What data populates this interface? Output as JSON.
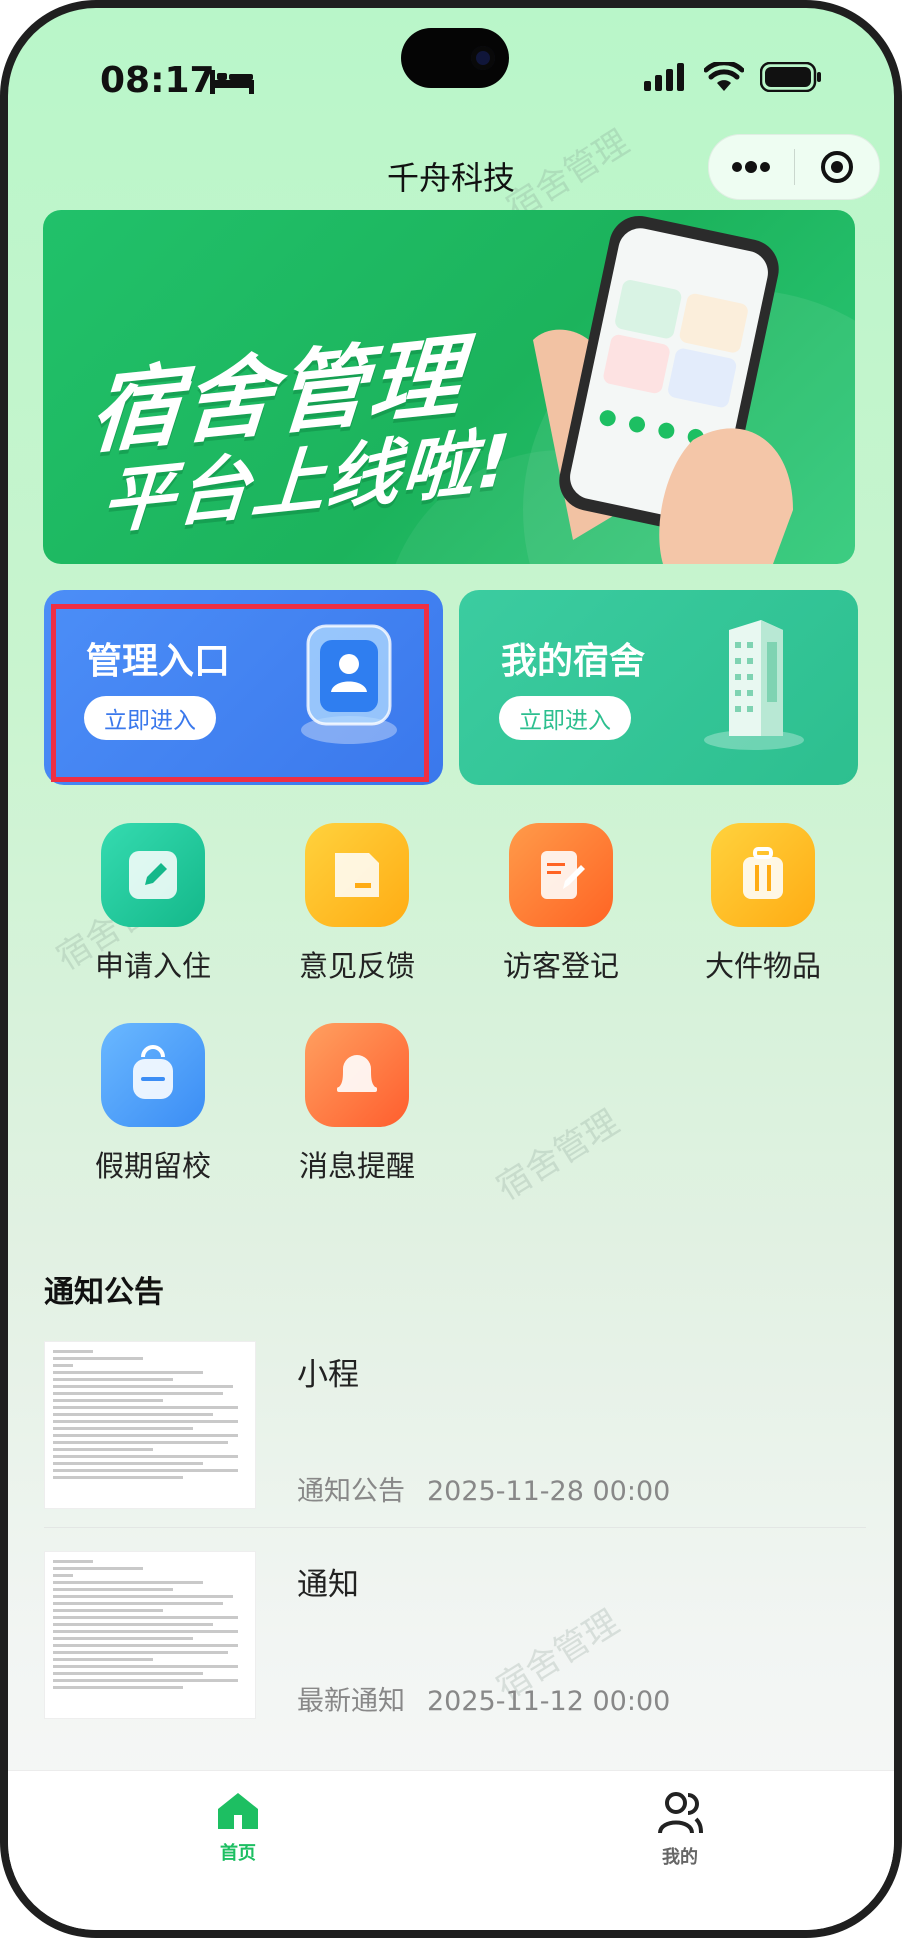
{
  "status_bar": {
    "time": "08:17"
  },
  "nav": {
    "title": "千舟科技"
  },
  "banner": {
    "line1": "宿舍管理",
    "line2": "平台上线啦!"
  },
  "cards": [
    {
      "title": "管理入口",
      "button": "立即进入"
    },
    {
      "title": "我的宿舍",
      "button": "立即进入"
    }
  ],
  "quick_actions": [
    {
      "label": "申请入住",
      "icon": "edit-icon",
      "color": "#1bc99a"
    },
    {
      "label": "意见反馈",
      "icon": "feedback-icon",
      "color": "#ffb81f"
    },
    {
      "label": "访客登记",
      "icon": "notebook-pen-icon",
      "color": "#ff7a36"
    },
    {
      "label": "大件物品",
      "icon": "luggage-icon",
      "color": "#ffb81f"
    },
    {
      "label": "假期留校",
      "icon": "backpack-icon",
      "color": "#4a9ef7"
    },
    {
      "label": "消息提醒",
      "icon": "bell-icon",
      "color": "#ff7a45"
    }
  ],
  "notices_section": {
    "title": "通知公告"
  },
  "notices": [
    {
      "title": "小程",
      "category": "通知公告",
      "datetime": "2025-11-28 00:00"
    },
    {
      "title": "通知",
      "category": "最新通知",
      "datetime": "2025-11-12 00:00"
    }
  ],
  "tabbar": {
    "home": "首页",
    "mine": "我的"
  },
  "watermark": "宿舍管理",
  "colors": {
    "brand_green": "#1dbf62",
    "admin_blue": "#3a78ec",
    "dorm_teal": "#2dbf8f",
    "highlight_red": "#ee2f44"
  }
}
